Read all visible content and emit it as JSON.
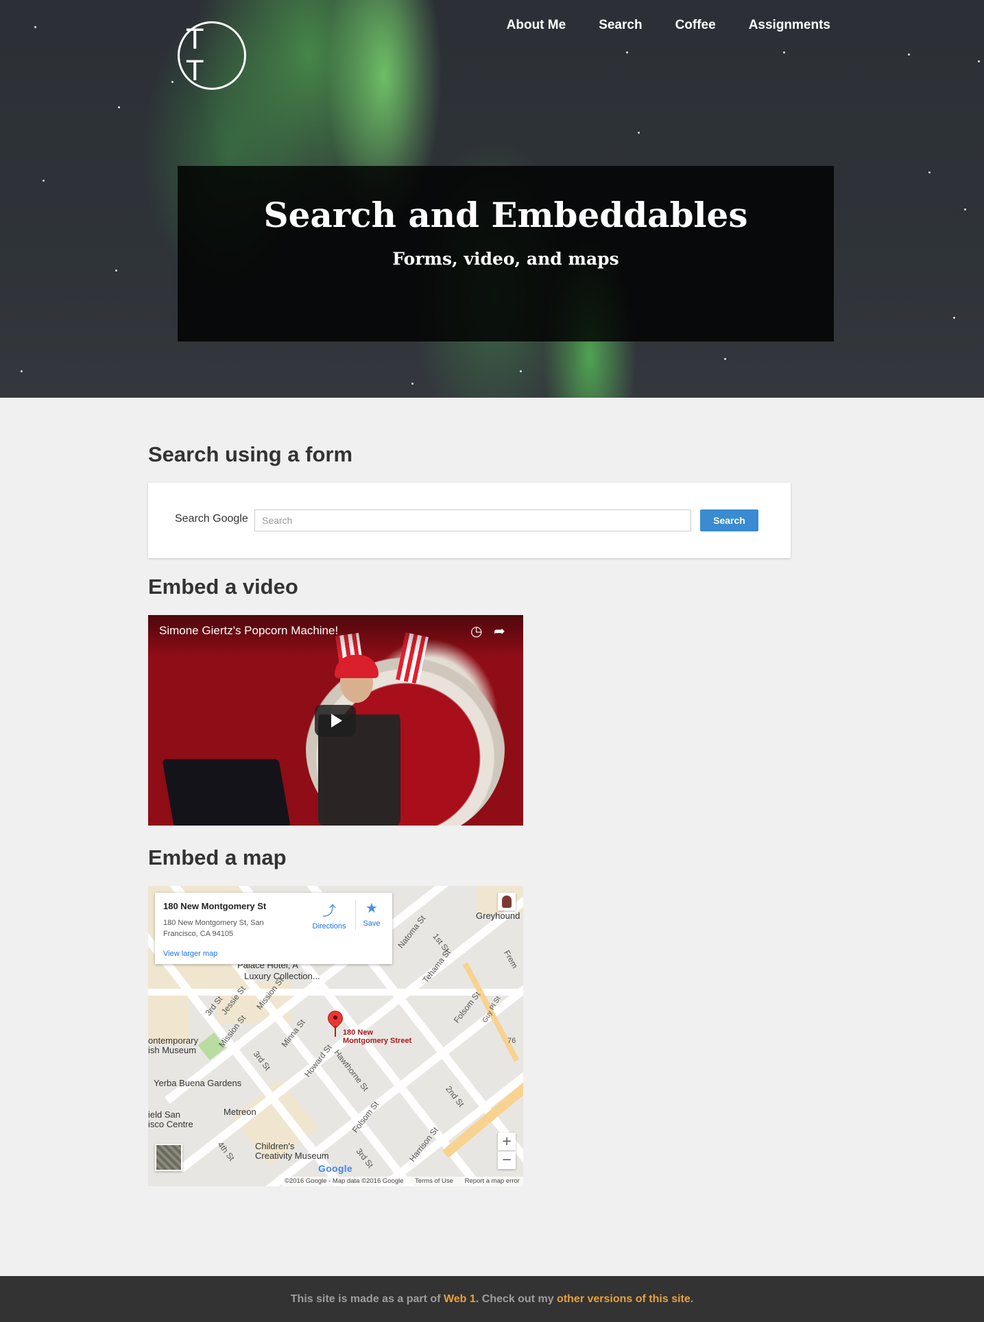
{
  "logo": {
    "initials": "T T"
  },
  "nav": {
    "items": [
      {
        "label": "About Me"
      },
      {
        "label": "Search"
      },
      {
        "label": "Coffee"
      },
      {
        "label": "Assignments"
      }
    ]
  },
  "hero": {
    "title": "Search and Embeddables",
    "subtitle": "Forms, video, and maps"
  },
  "sections": {
    "form_title": "Search using a form",
    "video_title": "Embed a video",
    "map_title": "Embed a map"
  },
  "search_form": {
    "label": "Search Google",
    "placeholder": "Search",
    "value": "",
    "button_label": "Search"
  },
  "video": {
    "title": "Simone Giertz's Popcorn Machine!",
    "icons": [
      "watch-later-icon",
      "share-icon",
      "play-icon"
    ]
  },
  "map": {
    "place_name": "180 New Montgomery St",
    "address_line1": "180 New Montgomery St, San",
    "address_line2": "Francisco, CA 94105",
    "directions_label": "Directions",
    "save_label": "Save",
    "view_larger_label": "View larger map",
    "pin_label_1": "180 New",
    "pin_label_2": "Montgomery Street",
    "places": {
      "greyhound": "Greyhound I",
      "palace_1": "Palace Hotel, A",
      "palace_2": "Luxury Collection...",
      "museum_1": "ontemporary",
      "museum_2": "ish Museum",
      "yerba": "Yerba Buena Gardens",
      "metreon": "Metreon",
      "yield_1": "ield San",
      "yield_2": "isco Centre",
      "childrens_1": "Children's",
      "childrens_2": "Creativity Museum",
      "route": "76"
    },
    "streets": {
      "jessie": "Jessie St",
      "mission": "Mission St",
      "third": "3rd St",
      "minna": "Minna St",
      "howard": "Howard St",
      "hawthorne": "Hawthorne St",
      "folsom": "Folsom St",
      "tehama": "Tehama St",
      "natoma": "Natoma St",
      "first": "1st St",
      "second": "2nd St",
      "harrison": "Harrison St",
      "fourth": "4th St",
      "guy": "Guy Pl St",
      "fremont": "Frem"
    },
    "google_logo": "Google",
    "footer": {
      "copyright": "©2016 Google - Map data ©2016 Google",
      "terms": "Terms of Use",
      "report": "Report a map error"
    },
    "zoom_in": "+",
    "zoom_out": "−"
  },
  "footer": {
    "text_1": "This site is made as a part of ",
    "link_1": "Web 1",
    "text_2": ". Check out my ",
    "link_2": "other versions of this site",
    "text_3": "."
  },
  "colors": {
    "accent_button": "#3a8bd1",
    "footer_link": "#e8a13a",
    "footer_bg": "#333333",
    "page_bg": "#f0f0f0"
  }
}
